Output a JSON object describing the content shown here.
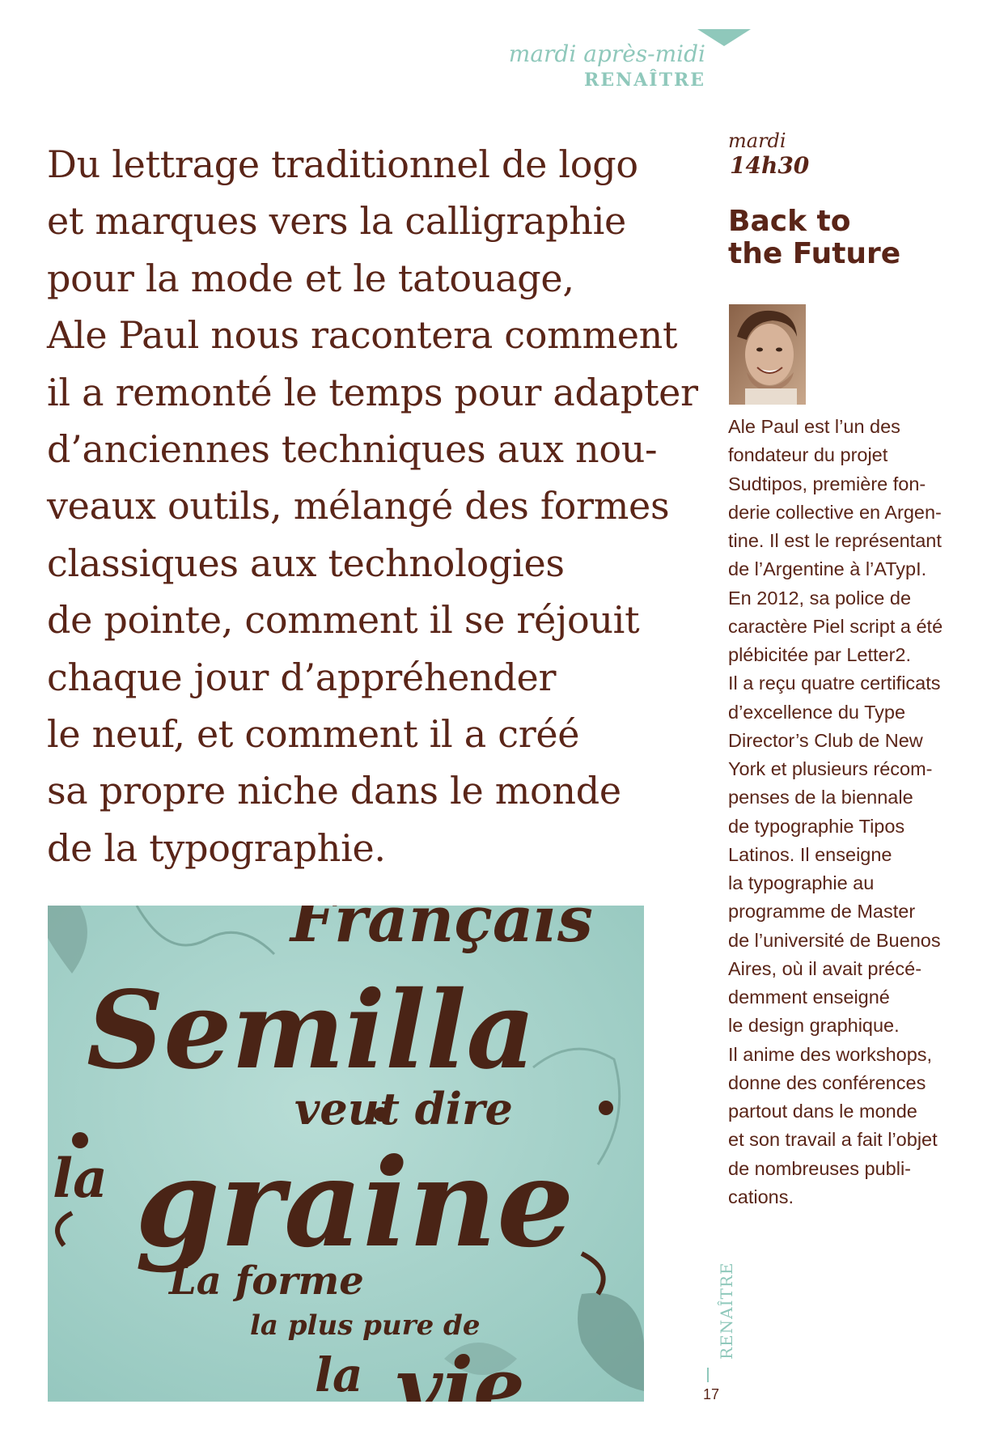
{
  "header": {
    "day": "mardi après-midi",
    "section": "RENAÎTRE"
  },
  "lead": {
    "lines": [
      "Du lettrage traditionnel de logo",
      "et marques vers la calligraphie",
      "pour la mode et le tatouage,",
      "Ale Paul nous racontera comment",
      "il a remonté le temps pour adapter",
      "d’anciennes techniques aux nou-",
      "veaux outils, mélangé des formes",
      "classiques aux technologies",
      "de pointe, comment il se réjouit",
      "chaque jour d’appréhender",
      "le neuf, et comment il a créé",
      "sa propre niche dans le monde",
      "de la typographie."
    ]
  },
  "session": {
    "day": "mardi",
    "time": "14h30",
    "title_lines": [
      "Back to",
      "the Future"
    ]
  },
  "bio": {
    "lines": [
      "Ale Paul est l’un des",
      "fondateur du projet",
      "Sudtipos, première fon-",
      "derie collective en Argen-",
      "tine. Il est le représentant",
      "de l’Argentine à l’ATypI.",
      "En 2012, sa police de",
      "caractère Piel script a été",
      "plébicitée par Letter2.",
      "Il a reçu quatre certificats",
      "d’excellence du Type",
      "Director’s Club de New",
      "York et plusieurs récom-",
      "penses de la biennale",
      "de typographie Tipos",
      "Latinos. Il enseigne",
      "la typographie au",
      "programme de Master",
      "de l’université de Buenos",
      "Aires, où il avait précé-",
      "demment enseigné",
      "le design graphique.",
      "Il anime des workshops,",
      "donne des conférences",
      "partout dans le monde",
      "et son travail a fait l’objet",
      "de nombreuses publi-",
      "cations."
    ]
  },
  "artwork": {
    "lines": [
      "Français",
      "Semilla",
      "veut dire",
      "la",
      "graine",
      "La forme",
      "la plus pure de",
      "la",
      "vie"
    ]
  },
  "footer": {
    "side_label": "RENAÎTRE",
    "page_number": "17"
  },
  "colors": {
    "text": "#5a2518",
    "accent": "#8fc8bb",
    "artwork_background": "#a4d3cb"
  }
}
